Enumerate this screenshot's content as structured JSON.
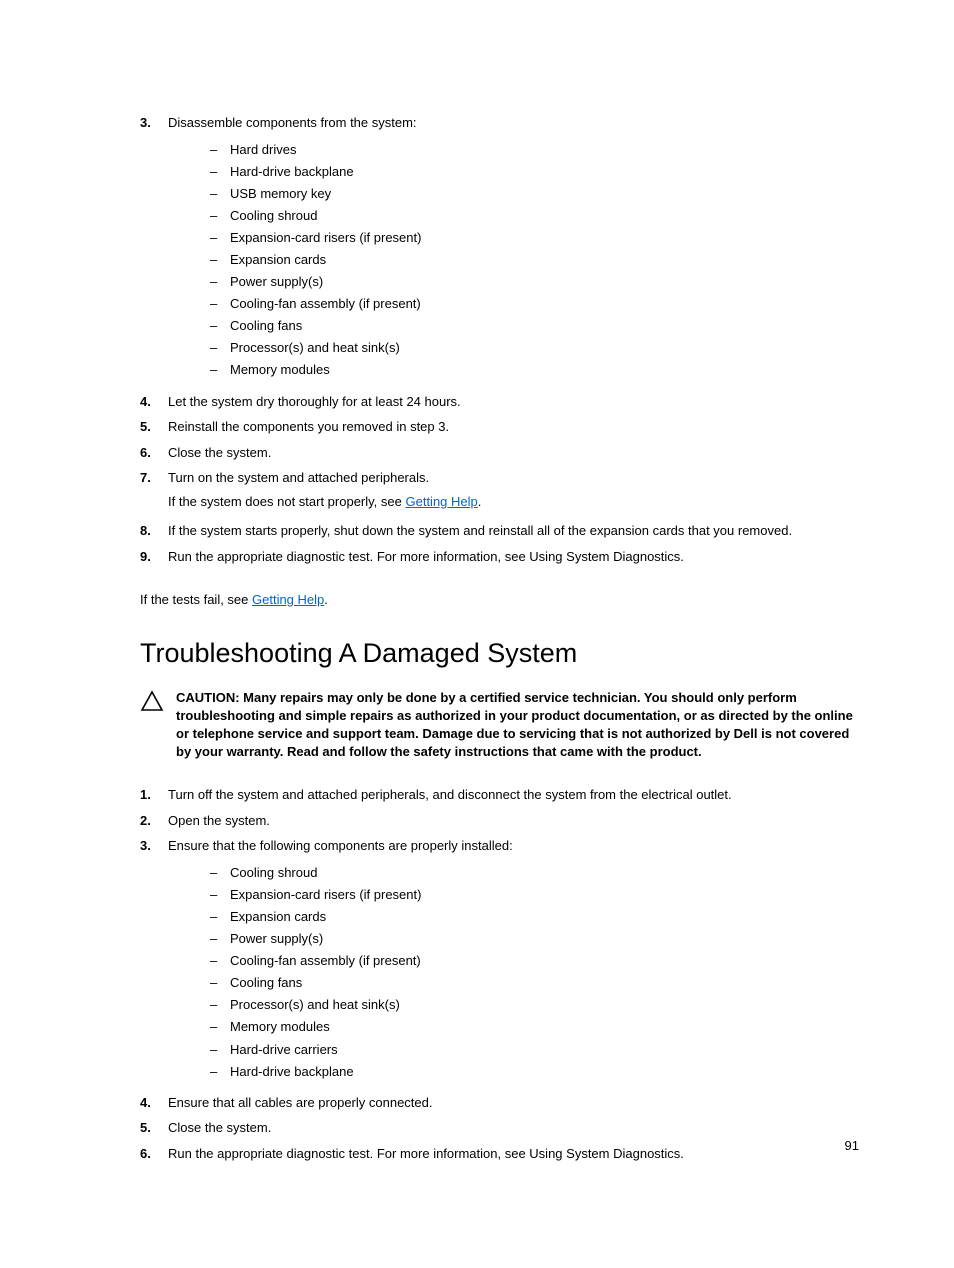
{
  "top_steps": {
    "step3": {
      "num": "3.",
      "text": "Disassemble components from the system:",
      "items": [
        "Hard drives",
        "Hard-drive backplane",
        "USB memory key",
        "Cooling shroud",
        "Expansion-card risers (if present)",
        "Expansion cards",
        "Power supply(s)",
        "Cooling-fan assembly (if present)",
        "Cooling fans",
        "Processor(s) and heat sink(s)",
        "Memory modules"
      ]
    },
    "step4": {
      "num": "4.",
      "text": "Let the system dry thoroughly for at least 24 hours."
    },
    "step5": {
      "num": "5.",
      "text": "Reinstall the components you removed in step 3."
    },
    "step6": {
      "num": "6.",
      "text": "Close the system."
    },
    "step7": {
      "num": "7.",
      "line1": "Turn on the system and attached peripherals.",
      "line2a": "If the system does not start properly, see ",
      "line2_link": "Getting Help",
      "line2b": "."
    },
    "step8": {
      "num": "8.",
      "text": "If the system starts properly, shut down the system and reinstall all of the expansion cards that you removed."
    },
    "step9": {
      "num": "9.",
      "text": "Run the appropriate diagnostic test. For more information, see Using System Diagnostics."
    }
  },
  "fail_para_a": "If the tests fail, see ",
  "fail_link": "Getting Help",
  "fail_para_b": ".",
  "heading": "Troubleshooting A Damaged System",
  "caution": "CAUTION: Many repairs may only be done by a certified service technician. You should only perform troubleshooting and simple repairs as authorized in your product documentation, or as directed by the online or telephone service and support team. Damage due to servicing that is not authorized by Dell is not covered by your warranty. Read and follow the safety instructions that came with the product.",
  "bottom_steps": {
    "step1": {
      "num": "1.",
      "text": "Turn off the system and attached peripherals, and disconnect the system from the electrical outlet."
    },
    "step2": {
      "num": "2.",
      "text": "Open the system."
    },
    "step3": {
      "num": "3.",
      "text": "Ensure that the following components are properly installed:",
      "items": [
        "Cooling shroud",
        "Expansion-card risers (if present)",
        "Expansion cards",
        "Power supply(s)",
        "Cooling-fan assembly (if present)",
        "Cooling fans",
        "Processor(s) and heat sink(s)",
        "Memory modules",
        "Hard-drive carriers",
        "Hard-drive backplane"
      ]
    },
    "step4": {
      "num": "4.",
      "text": "Ensure that all cables are properly connected."
    },
    "step5": {
      "num": "5.",
      "text": "Close the system."
    },
    "step6": {
      "num": "6.",
      "text": "Run the appropriate diagnostic test. For more information, see Using System Diagnostics."
    }
  },
  "page_number": "91"
}
